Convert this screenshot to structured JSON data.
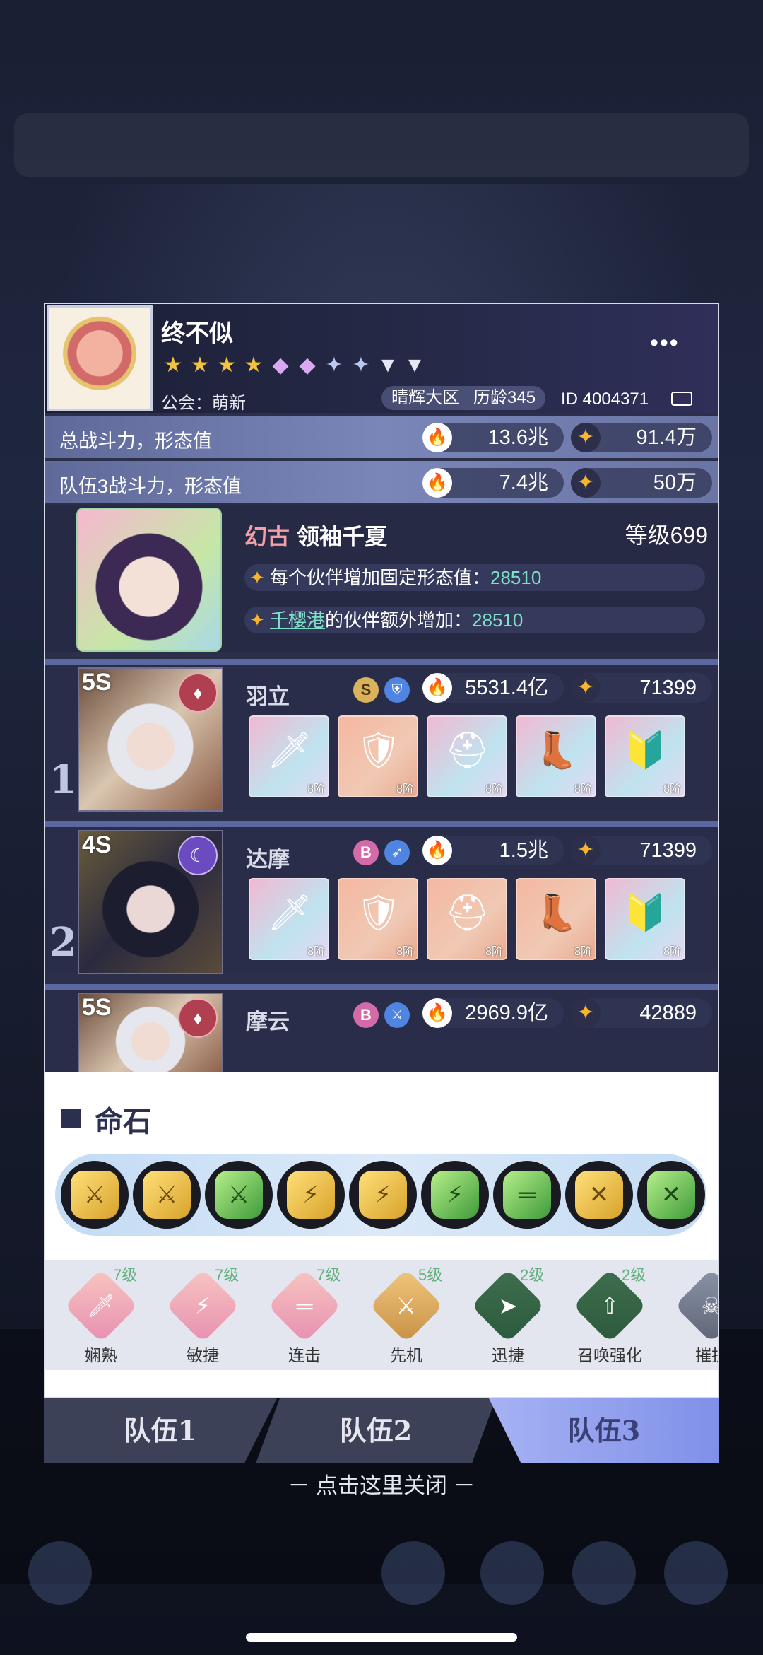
{
  "player": {
    "name": "终不似",
    "guild": "公会：萌新",
    "server": "晴辉大区",
    "age": "历龄345",
    "id": "ID 4004371",
    "more_label": "•••",
    "stars": [
      "gold",
      "gold",
      "gold",
      "gold",
      "purple",
      "purple",
      "blue",
      "blue",
      "silver",
      "silver"
    ]
  },
  "power_total": {
    "label": "总战斗力，形态值",
    "power": "13.6兆",
    "form": "91.4万"
  },
  "power_team": {
    "label": "队伍3战斗力，形态值",
    "power": "7.4兆",
    "form": "50万"
  },
  "leader": {
    "tag": "幻古",
    "name": "领袖千夏",
    "level": "等级699",
    "bonus1_text": "每个伙伴增加固定形态值：",
    "bonus1_value": "28510",
    "bonus2_place": "千樱港",
    "bonus2_text": "的伙伴额外增加：",
    "bonus2_value": "28510"
  },
  "team": [
    {
      "index": "1",
      "tier": "5S",
      "name": "羽立",
      "rank": "S",
      "power": "5531.4亿",
      "form": "71399",
      "equip_stage": "8阶"
    },
    {
      "index": "2",
      "tier": "4S",
      "name": "达摩",
      "rank": "B",
      "power": "1.5兆",
      "form": "71399",
      "equip_stage": "8阶"
    },
    {
      "index": "",
      "tier": "5S",
      "name": "摩云",
      "rank": "B",
      "power": "2969.9亿",
      "form": "42889",
      "equip_stage": ""
    }
  ],
  "mingshi": {
    "title": "命石",
    "stones": [
      "gold",
      "gold",
      "green",
      "gold",
      "gold",
      "green",
      "green",
      "gold",
      "green"
    ]
  },
  "skills": [
    {
      "name": "娴熟",
      "level": "7级",
      "color": "pink",
      "icon": "sword-icon"
    },
    {
      "name": "敏捷",
      "level": "7级",
      "color": "pink",
      "icon": "lightning-icon"
    },
    {
      "name": "连击",
      "level": "7级",
      "color": "pink",
      "icon": "blade-icon"
    },
    {
      "name": "先机",
      "level": "5级",
      "color": "gold",
      "icon": "cross-swords-icon"
    },
    {
      "name": "迅捷",
      "level": "2级",
      "color": "dg",
      "icon": "dash-icon"
    },
    {
      "name": "召唤强化",
      "level": "2级",
      "color": "dg",
      "icon": "summon-icon"
    },
    {
      "name": "摧抗",
      "level": "",
      "color": "gray",
      "icon": "skull-icon"
    }
  ],
  "tabs": {
    "t1": "队伍1",
    "t2": "队伍2",
    "t3": "队伍3"
  },
  "close_hint": "－ 点击这里关闭 －"
}
